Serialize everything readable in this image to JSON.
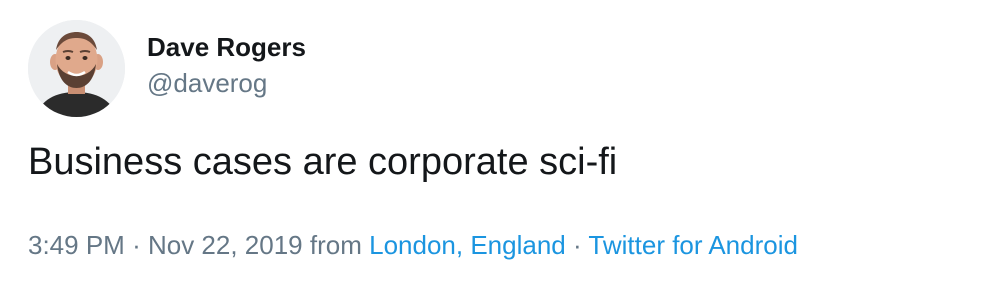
{
  "user": {
    "display_name": "Dave Rogers",
    "handle": "@daverog"
  },
  "tweet": {
    "text": "Business cases are corporate sci-fi"
  },
  "meta": {
    "time": "3:49 PM",
    "separator": "·",
    "date": "Nov 22, 2019",
    "from_label": "from",
    "location": "London, England",
    "client": "Twitter for Android"
  },
  "colors": {
    "text": "#14171a",
    "muted": "#657786",
    "link": "#1b95e0"
  }
}
